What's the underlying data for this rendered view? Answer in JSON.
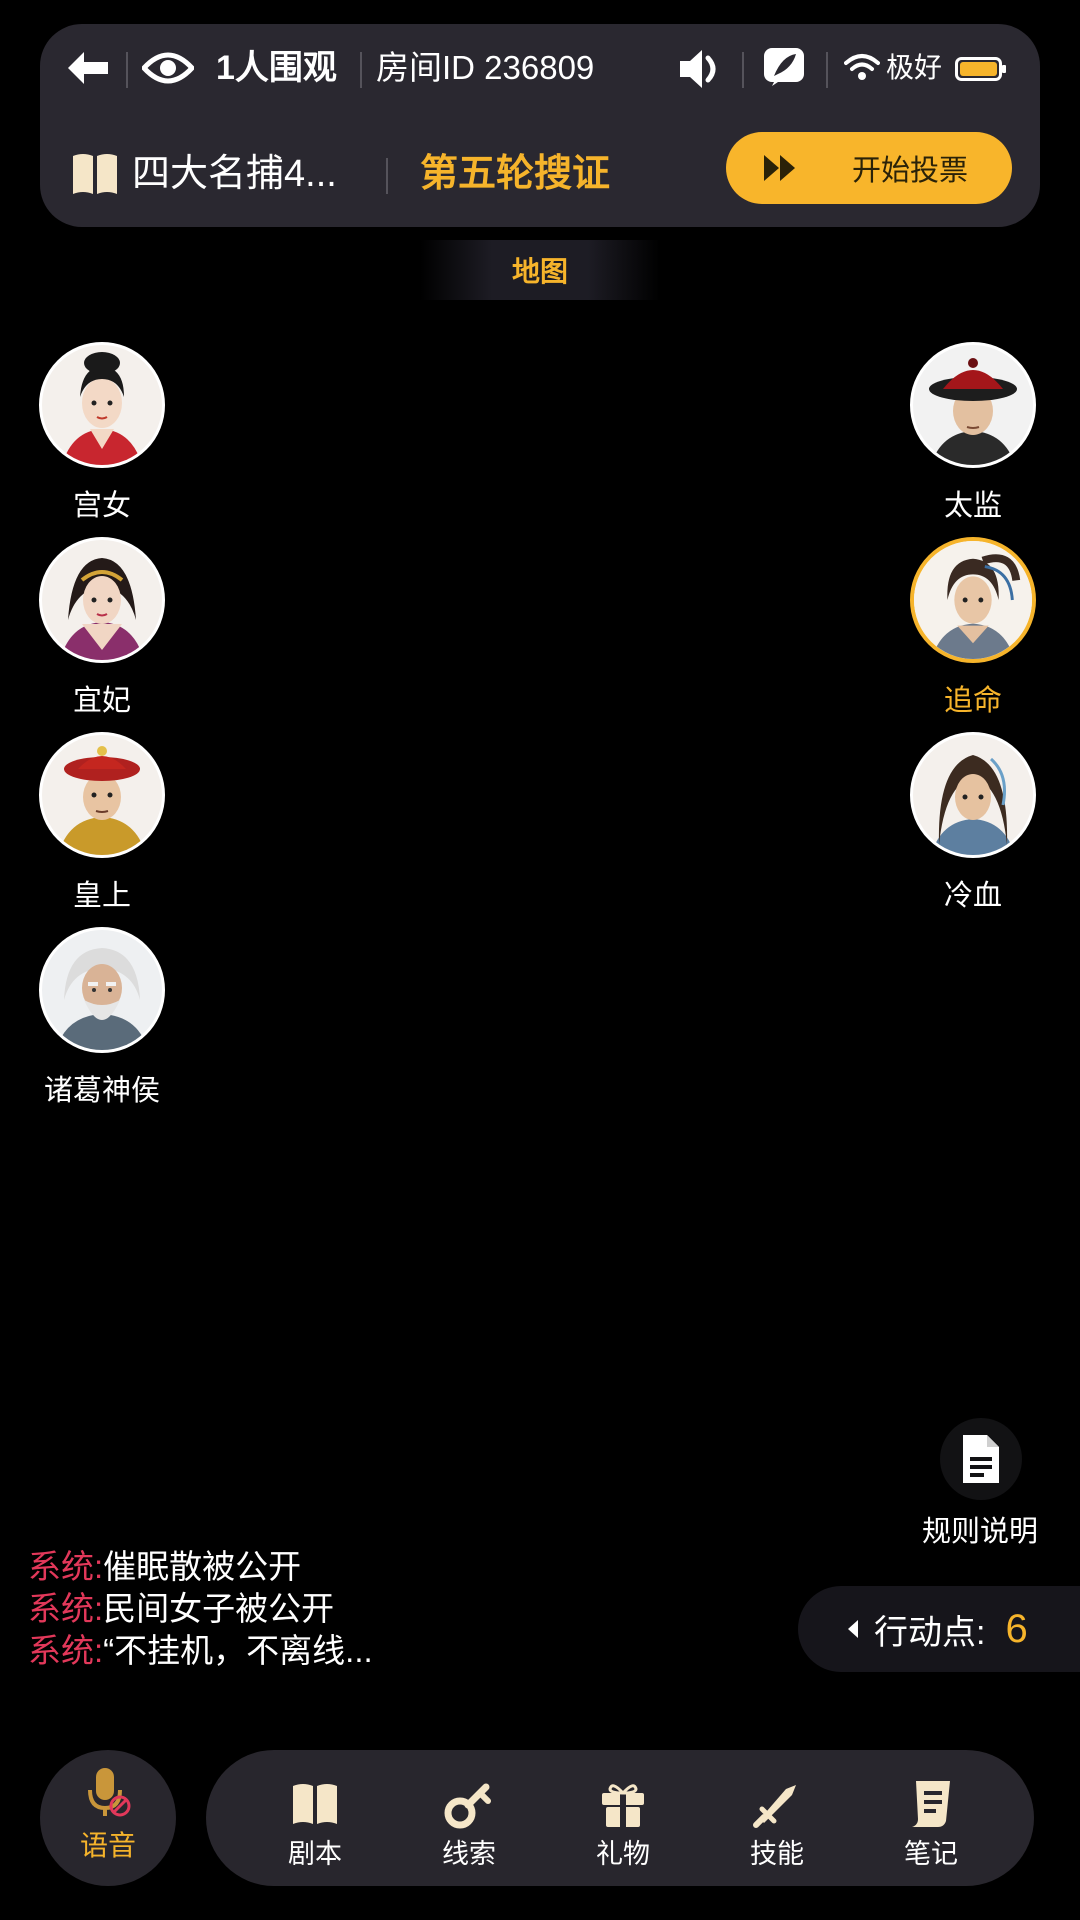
{
  "header": {
    "viewers": "1人围观",
    "room_id": "房间ID 236809",
    "signal": "极好",
    "script_name": "四大名捕4...",
    "round_title": "第五轮搜证",
    "vote_button": "开始投票"
  },
  "map_tab": "地图",
  "players_left": [
    {
      "name": "宫女"
    },
    {
      "name": "宜妃"
    },
    {
      "name": "皇上"
    },
    {
      "name": "诸葛神侯"
    }
  ],
  "players_right": [
    {
      "name": "太监"
    },
    {
      "name": "追命",
      "selected": true
    },
    {
      "name": "冷血"
    }
  ],
  "rules_label": "规则说明",
  "chat": [
    {
      "sender": "系统:",
      "text": "催眠散被公开"
    },
    {
      "sender": "系统:",
      "text": "民间女子被公开"
    },
    {
      "sender": "系统:",
      "text": "“不挂机，不离线..."
    }
  ],
  "action_points": {
    "label": "行动点:",
    "value": "6"
  },
  "bottom_bar": {
    "voice": "语音",
    "script": "剧本",
    "clues": "线索",
    "gift": "礼物",
    "skill": "技能",
    "notes": "笔记"
  },
  "colors": {
    "accent": "#f6b42b",
    "system": "#e2385a",
    "panel": "#2a2830"
  },
  "icons": [
    "back-arrow-icon",
    "eye-icon",
    "speaker-icon",
    "feather-icon",
    "wifi-icon",
    "battery-icon",
    "book-icon",
    "fast-forward-icon",
    "document-icon",
    "microphone-muted-icon",
    "key-icon",
    "gift-icon",
    "sword-icon",
    "notes-icon"
  ]
}
